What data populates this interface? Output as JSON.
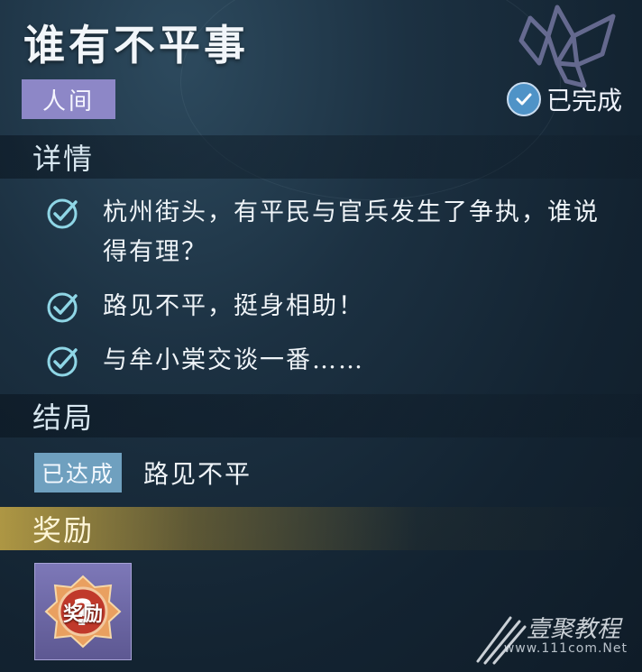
{
  "quest": {
    "title": "谁有不平事",
    "category": "人间",
    "status": "已完成"
  },
  "details": {
    "header": "详情",
    "items": [
      {
        "text": "杭州街头，有平民与官兵发生了争执，谁说得有理？"
      },
      {
        "text": "路见不平，挺身相助！"
      },
      {
        "text": "与牟小棠交谈一番……"
      }
    ]
  },
  "ending": {
    "header": "结局",
    "badge": "已达成",
    "name": "路见不平"
  },
  "rewards": {
    "header": "奖励",
    "item_label": "奖励"
  },
  "watermark": {
    "brand": "壹聚教程",
    "url": "www.111com.Net"
  },
  "colors": {
    "category_tag": "#8d87c7",
    "status_check": "#4f93c7",
    "check_teal": "#8fd6e6",
    "ending_badge": "#6fa0bf",
    "reward_gold_header": "#c8aa46",
    "reward_card": "#6e69a8"
  },
  "icons": {
    "status": "check-circle-icon",
    "detail_item": "check-circle-icon",
    "reward": "mystery-reward-icon",
    "emblem": "butterfly-emblem-icon"
  }
}
